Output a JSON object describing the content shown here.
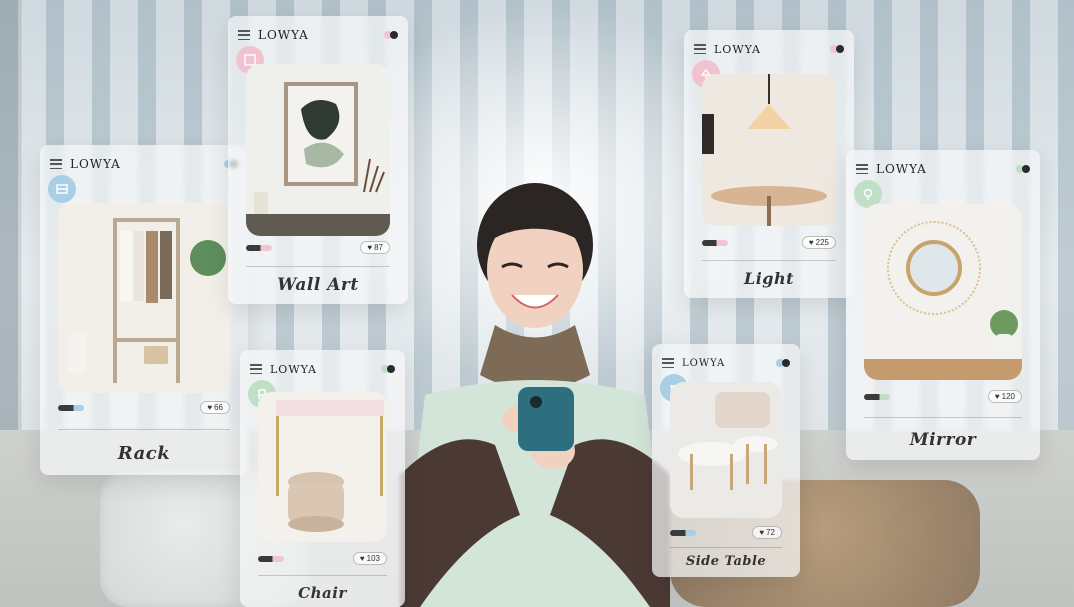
{
  "brand": "LOWYA",
  "colors": {
    "accent_pink": "#f1c3d0",
    "accent_blue": "#a9cfe6",
    "accent_green": "#bfe0c6",
    "dark_dot": "#2a2a2a"
  },
  "cards": {
    "rack": {
      "title": "Rack",
      "likes": "66",
      "badge_icon": "shelf-icon"
    },
    "wall_art": {
      "title": "Wall Art",
      "likes": "87",
      "badge_icon": "frame-icon"
    },
    "chair": {
      "title": "Chair",
      "likes": "103",
      "badge_icon": "chair-icon"
    },
    "light": {
      "title": "Light",
      "likes": "225",
      "badge_icon": "lamp-icon"
    },
    "side_table": {
      "title": "Side Table",
      "likes": "72",
      "badge_icon": "table-icon"
    },
    "mirror": {
      "title": "Mirror",
      "likes": "120",
      "badge_icon": "mirror-icon"
    }
  },
  "icons": {
    "menu": "menu-icon",
    "heart": "heart-icon"
  }
}
